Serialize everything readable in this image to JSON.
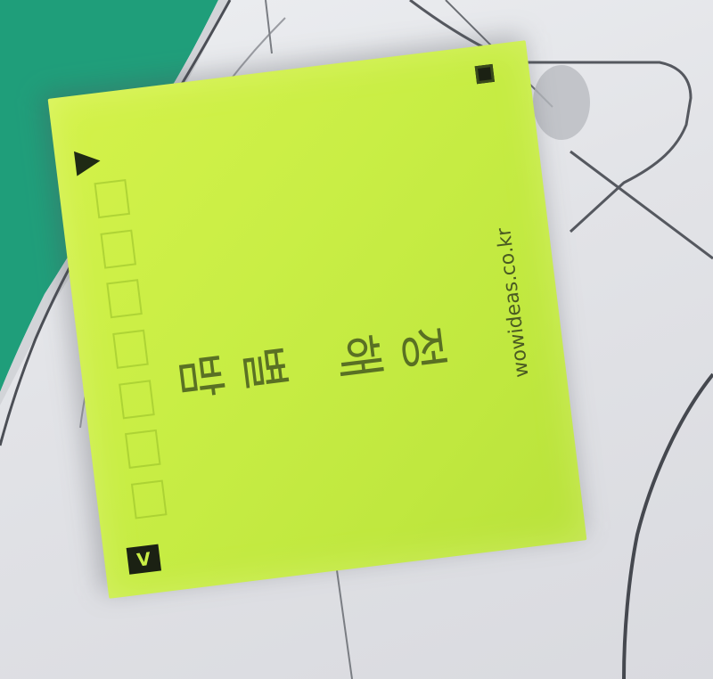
{
  "note": {
    "handwriting": "정해 별밤",
    "brand": "wowideas.co.kr",
    "color": "#c9ee45",
    "corner_marks": {
      "top_left_icon": "play-triangle-icon",
      "top_right_icon": "square-dot-icon",
      "bottom_left_label": "V"
    }
  },
  "background": {
    "teal_color": "#1f9e7a",
    "board_color": "#e4e5e8",
    "line_color": "#4b4e55"
  }
}
